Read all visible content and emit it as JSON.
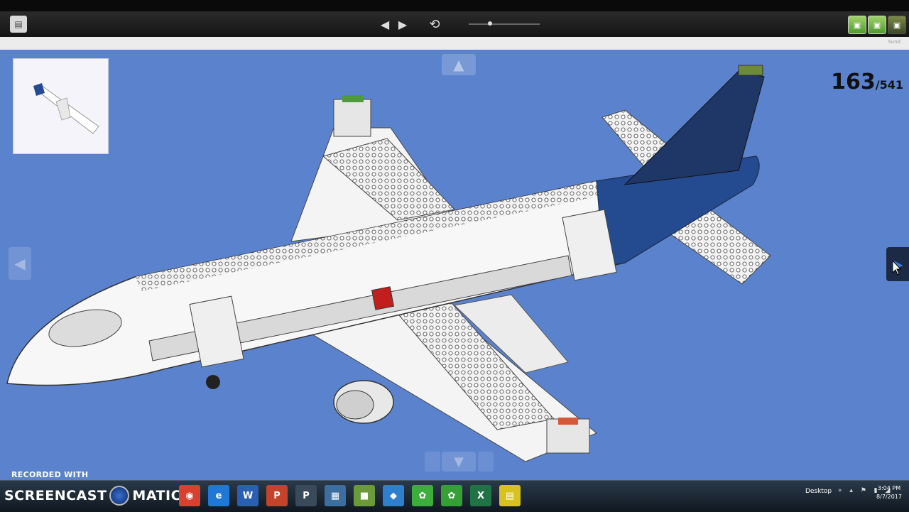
{
  "toolbar": {
    "file_icon": "document-icon",
    "prev_icon": "◀",
    "next_icon": "▶",
    "rotate_icon": "⟲",
    "slider_value": 0.3,
    "right_tool_icons": [
      "lego-brick-icon",
      "lego-brick-icon",
      "lego-brick-dark-icon"
    ]
  },
  "subbar": {
    "label": "Sund"
  },
  "viewer": {
    "page_current": "163",
    "page_total": "/541",
    "nav_up_icon": "▲",
    "nav_down_icon": "▼",
    "nav_left_icon": "◀",
    "nav_right_icon": "▶",
    "background_color": "#5b83cd"
  },
  "watermark": {
    "recorded_with": "RECORDED WITH"
  },
  "taskbar": {
    "logo_left": "SCREENCAST",
    "logo_right": "MATIC",
    "icons": [
      {
        "name": "chrome-icon",
        "glyph": "◉",
        "color": "#d8412f"
      },
      {
        "name": "ie-icon",
        "glyph": "e",
        "color": "#1f77d6"
      },
      {
        "name": "word-icon",
        "glyph": "W",
        "color": "#2b5fb3"
      },
      {
        "name": "powerpoint-icon",
        "glyph": "P",
        "color": "#c5432b"
      },
      {
        "name": "publisher-icon",
        "glyph": "P",
        "color": "#3a4a5a"
      },
      {
        "name": "file-explorer-icon",
        "glyph": "▦",
        "color": "#3d6f9e"
      },
      {
        "name": "lego-digital-designer-icon",
        "glyph": "■",
        "color": "#6a9a3a"
      },
      {
        "name": "store-icon",
        "glyph": "◆",
        "color": "#2f7fcf"
      },
      {
        "name": "lego-app-icon",
        "glyph": "✿",
        "color": "#3cae3c"
      },
      {
        "name": "lego-app-2-icon",
        "glyph": "✿",
        "color": "#36a036"
      },
      {
        "name": "excel-icon",
        "glyph": "X",
        "color": "#217346"
      },
      {
        "name": "sticky-icon",
        "glyph": "▤",
        "color": "#d8c21f"
      }
    ],
    "desktop_label": "Desktop",
    "tray": "» ▴ ⚑ ▮ ◢",
    "time": "3:04 PM",
    "date": "8/7/2017"
  }
}
